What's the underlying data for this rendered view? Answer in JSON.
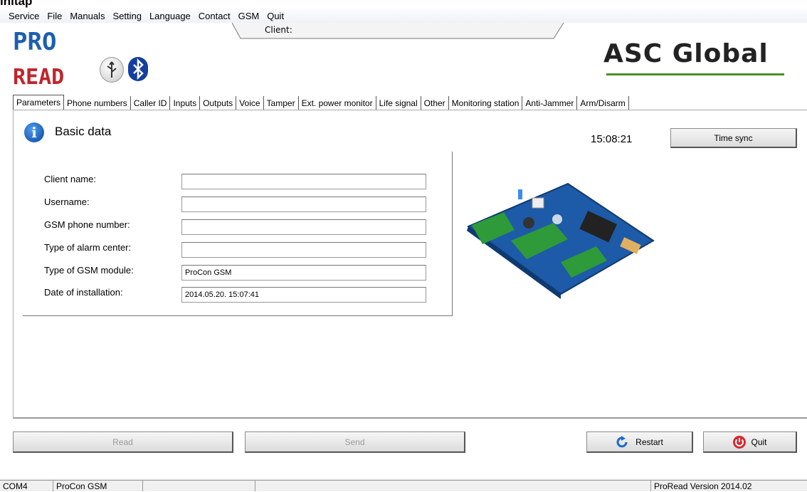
{
  "title_fragment": "ınıtap",
  "menu": [
    "Service",
    "File",
    "Manuals",
    "Setting",
    "Language",
    "Contact",
    "GSM",
    "Quit"
  ],
  "client_label": "Client:",
  "logo": {
    "line1": "PRO",
    "line2": "READ",
    "brand": "ASC Global"
  },
  "icons": {
    "usb": "usb-icon",
    "bluetooth": "bluetooth-icon",
    "info": "info-icon",
    "restart": "restart-arrow-icon",
    "quit": "power-icon"
  },
  "tabs": [
    "Parameters",
    "Phone numbers",
    "Caller ID",
    "Inputs",
    "Outputs",
    "Voice",
    "Tamper",
    "Ext. power monitor",
    "Life signal",
    "Other",
    "Monitoring station",
    "Anti-Jammer",
    "Arm/Disarm"
  ],
  "active_tab": "Parameters",
  "section_title": "Basic data",
  "clock": "15:08:21",
  "time_sync_label": "Time sync",
  "form": [
    {
      "label": "Client name:",
      "value": ""
    },
    {
      "label": "Username:",
      "value": ""
    },
    {
      "label": "GSM phone number:",
      "value": ""
    },
    {
      "label": "Type of alarm center:",
      "value": ""
    },
    {
      "label": "Type of GSM module:",
      "value": "ProCon GSM"
    },
    {
      "label": "Date of installation:",
      "value": "2014.05.20. 15:07:41"
    }
  ],
  "buttons": {
    "read": "Read",
    "send": "Send",
    "restart": "Restart",
    "quit": "Quit"
  },
  "status": {
    "port": "COM4",
    "module": "ProCon GSM",
    "empty1": "",
    "empty2": "",
    "version": "ProRead Version 2014.02"
  },
  "colors": {
    "brand_green": "#4b8f2a",
    "pro_blue": "#1d5fb0",
    "read_red": "#c0252c",
    "bluetooth_blue": "#143f9e"
  }
}
